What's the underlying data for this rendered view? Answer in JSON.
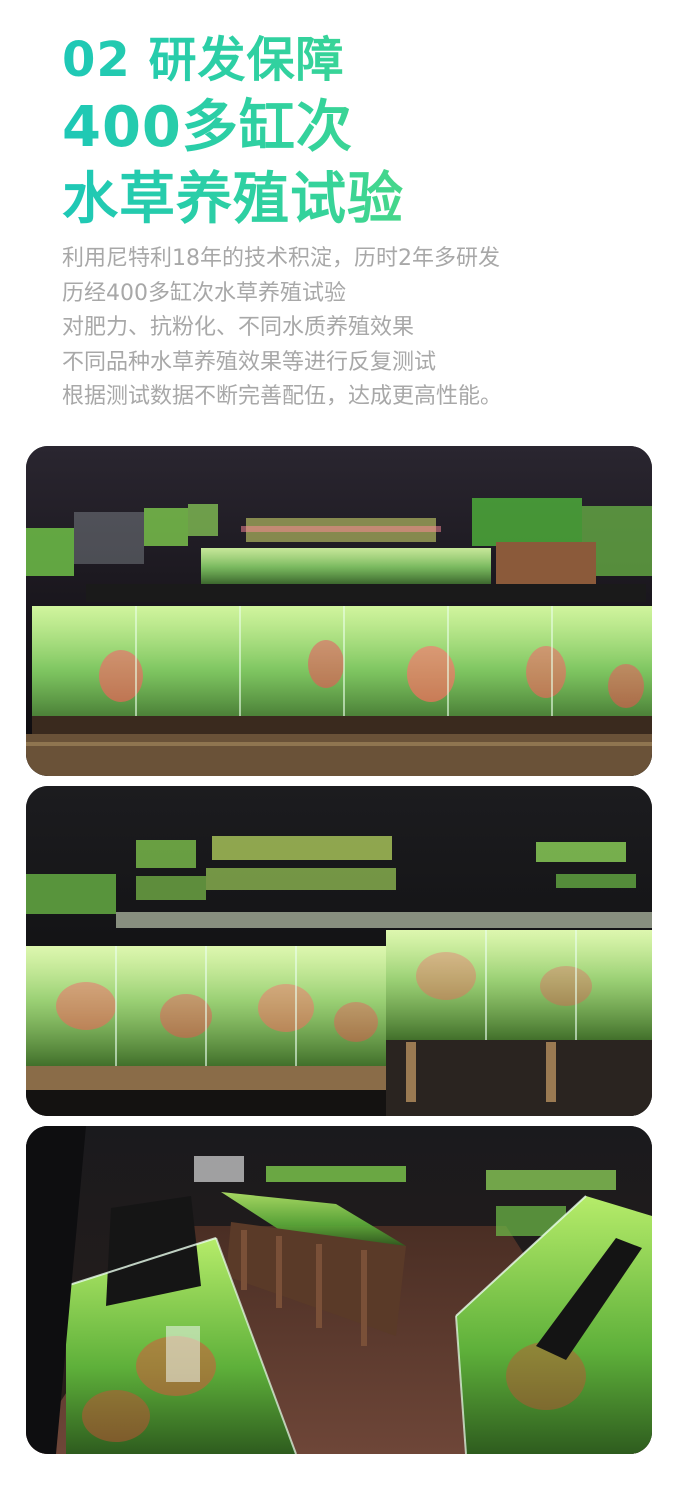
{
  "hero": {
    "line1": "02 研发保障",
    "line2": "400多缸次",
    "line3": "水草养殖试验"
  },
  "description": [
    "利用尼特利18年的技术积淀，历时2年多研发",
    "历经400多缸次水草养殖试验",
    "对肥力、抗粉化、不同水质养殖效果",
    "不同品种水草养殖效果等进行反复测试",
    "根据测试数据不断完善配伍，达成更高性能。"
  ],
  "colors": {
    "gradient_start": "#1ec8b6",
    "gradient_end": "#7be35a",
    "description_text": "#a8a8a8",
    "background": "#ffffff"
  }
}
